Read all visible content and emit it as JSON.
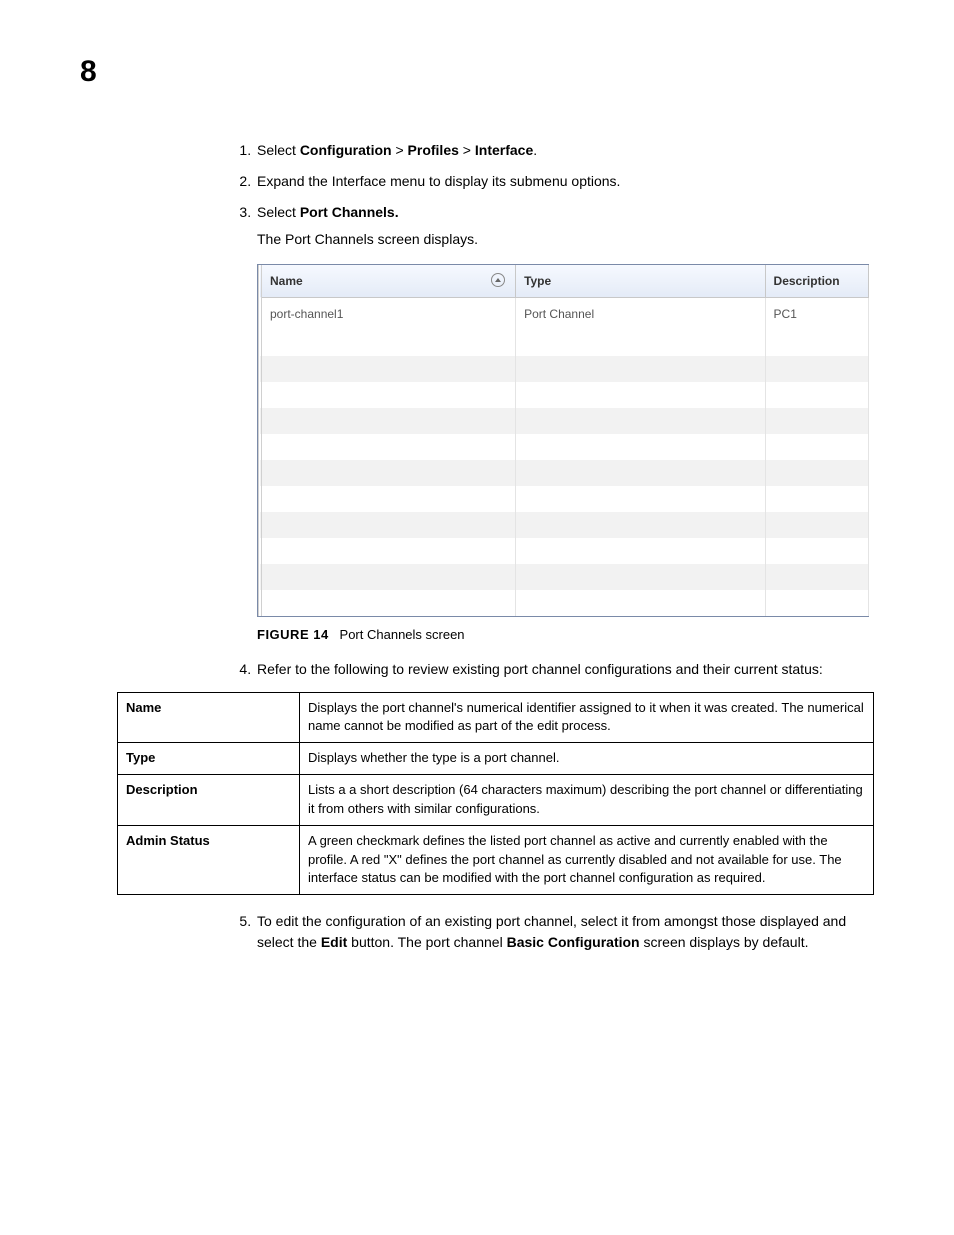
{
  "page_number": "8",
  "steps": {
    "s1": {
      "prefix": "Select ",
      "b1": "Configuration",
      "sep1": " > ",
      "b2": "Profiles",
      "sep2": " > ",
      "b3": "Interface",
      "suffix": "."
    },
    "s2": "Expand the Interface menu to display its submenu options.",
    "s3": {
      "prefix": "Select ",
      "b1": "Port Channels.",
      "sub": "The Port Channels screen displays."
    },
    "s4": "Refer to the following to review existing port channel configurations and their current status:",
    "s5": {
      "t1": "To edit the configuration of an existing port channel, select it from amongst those displayed and select the ",
      "b1": "Edit",
      "t2": " button. The port channel ",
      "b2": "Basic Configuration",
      "t3": " screen displays by default."
    }
  },
  "screenshot": {
    "headers": {
      "name": "Name",
      "type": "Type",
      "description": "Description"
    },
    "row": {
      "name": "port-channel1",
      "type": "Port Channel",
      "description": "PC1"
    }
  },
  "figure": {
    "label": "FIGURE 14",
    "caption": "Port Channels screen"
  },
  "definitions": {
    "name": {
      "term": "Name",
      "desc": "Displays the port channel's numerical identifier assigned to it when it was created. The numerical name cannot be modified as part of the edit process."
    },
    "type": {
      "term": "Type",
      "desc": "Displays whether the type is a port channel."
    },
    "description": {
      "term": "Description",
      "desc": "Lists a a short description (64 characters maximum) describing the port channel or differentiating it from others with similar configurations."
    },
    "admin_status": {
      "term": "Admin Status",
      "desc": "A green checkmark defines the listed port channel as active and currently enabled with the profile. A red \"X\" defines the port channel as currently disabled and not available for use. The interface status can be modified with the port channel configuration as required."
    }
  }
}
